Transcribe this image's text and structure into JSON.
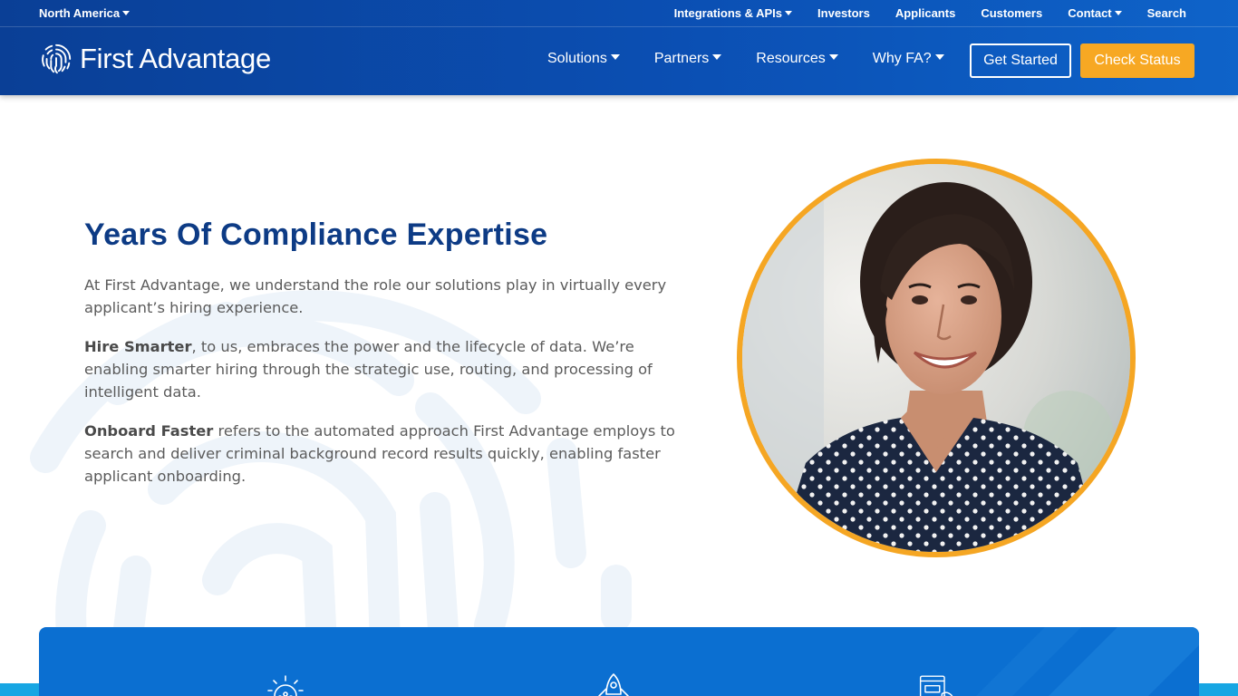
{
  "header": {
    "region": "North America",
    "utility_links": [
      {
        "label": "Integrations & APIs",
        "dropdown": true
      },
      {
        "label": "Investors",
        "dropdown": false
      },
      {
        "label": "Applicants",
        "dropdown": false
      },
      {
        "label": "Customers",
        "dropdown": false
      },
      {
        "label": "Contact",
        "dropdown": true
      },
      {
        "label": "Search",
        "dropdown": false
      }
    ],
    "logo_text": "First Advantage",
    "nav": [
      {
        "label": "Solutions"
      },
      {
        "label": "Partners"
      },
      {
        "label": "Resources"
      },
      {
        "label": "Why FA?"
      }
    ],
    "get_started": "Get Started",
    "check_status": "Check Status"
  },
  "main": {
    "heading": "Years Of Compliance Expertise",
    "para1": "At First Advantage, we understand the role our solutions play in virtually every applicant’s hiring experience.",
    "para2_bold": "Hire Smarter",
    "para2_rest": ", to us, embraces the power and the lifecycle of data. We’re enabling smarter hiring through the strategic use, routing, and processing of intelligent data.",
    "para3_bold": "Onboard Faster",
    "para3_rest": " refers to the automated approach First Advantage employs to search and deliver criminal background record results quickly, enabling faster applicant onboarding."
  },
  "colors": {
    "header_blue": "#0b4fb3",
    "heading_blue": "#0d3b85",
    "accent_orange": "#f7a823",
    "band_blue": "#0b6fd1"
  },
  "icons": [
    "fingerprint-logo-icon",
    "lightbulb-icon",
    "rocket-icon",
    "document-hand-icon"
  ]
}
